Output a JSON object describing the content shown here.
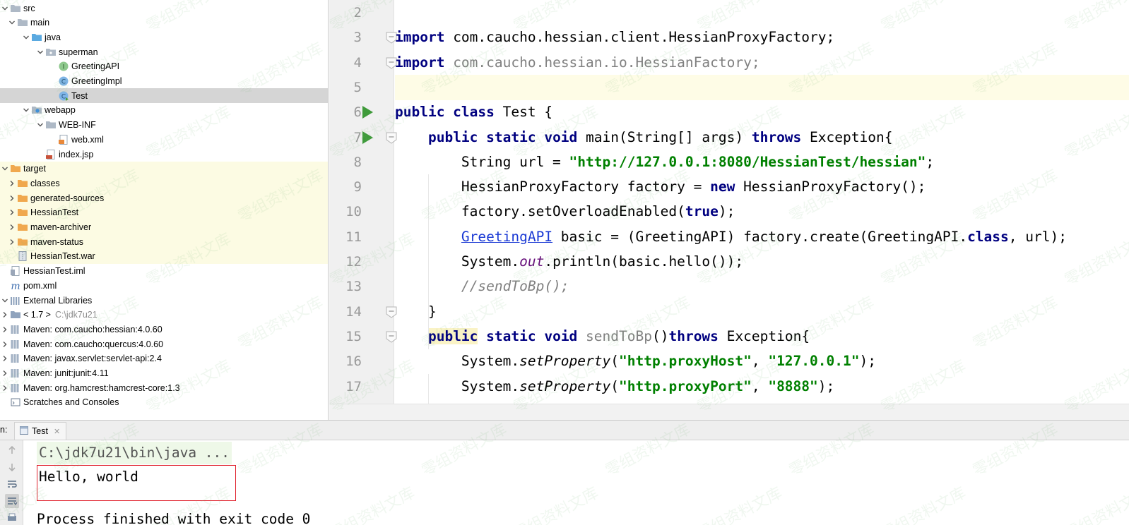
{
  "tree": [
    {
      "label": "src",
      "hint": "",
      "icon": "folder-icon",
      "expanded": true
    },
    {
      "label": "main",
      "hint": "",
      "icon": "folder-icon",
      "expanded": true
    },
    {
      "label": "java",
      "hint": "",
      "icon": "source-folder-icon",
      "expanded": true
    },
    {
      "label": "superman",
      "hint": "",
      "icon": "package-icon",
      "expanded": true
    },
    {
      "label": "GreetingAPI",
      "hint": "",
      "icon": "interface-icon",
      "expanded": null
    },
    {
      "label": "GreetingImpl",
      "hint": "",
      "icon": "class-icon",
      "expanded": null
    },
    {
      "label": "Test",
      "hint": "",
      "icon": "class-runnable-icon",
      "expanded": null,
      "selected": true
    },
    {
      "label": "webapp",
      "hint": "",
      "icon": "web-folder-icon",
      "expanded": true
    },
    {
      "label": "WEB-INF",
      "hint": "",
      "icon": "folder-icon",
      "expanded": true
    },
    {
      "label": "web.xml",
      "hint": "",
      "icon": "xml-file-icon",
      "expanded": null
    },
    {
      "label": "index.jsp",
      "hint": "",
      "icon": "jsp-file-icon",
      "expanded": null
    },
    {
      "label": "target",
      "hint": "",
      "icon": "excluded-folder-icon",
      "expanded": true,
      "excluded": true
    },
    {
      "label": "classes",
      "hint": "",
      "icon": "excluded-folder-icon",
      "expanded": false,
      "excluded": true
    },
    {
      "label": "generated-sources",
      "hint": "",
      "icon": "excluded-folder-icon",
      "expanded": false,
      "excluded": true
    },
    {
      "label": "HessianTest",
      "hint": "",
      "icon": "excluded-folder-icon",
      "expanded": false,
      "excluded": true
    },
    {
      "label": "maven-archiver",
      "hint": "",
      "icon": "excluded-folder-icon",
      "expanded": false,
      "excluded": true
    },
    {
      "label": "maven-status",
      "hint": "",
      "icon": "excluded-folder-icon",
      "expanded": false,
      "excluded": true
    },
    {
      "label": "HessianTest.war",
      "hint": "",
      "icon": "archive-file-icon",
      "expanded": null,
      "excluded": true
    },
    {
      "label": "HessianTest.iml",
      "hint": "",
      "icon": "module-file-icon",
      "expanded": null
    },
    {
      "label": "pom.xml",
      "hint": "",
      "icon": "maven-pom-icon",
      "expanded": null
    },
    {
      "label": "External Libraries",
      "hint": "",
      "icon": "libraries-icon",
      "expanded": true
    },
    {
      "label": "< 1.7 >",
      "hint": "C:\\jdk7u21",
      "icon": "jdk-icon",
      "expanded": false
    },
    {
      "label": "Maven: com.caucho:hessian:4.0.60",
      "hint": "",
      "icon": "library-icon",
      "expanded": false
    },
    {
      "label": "Maven: com.caucho:quercus:4.0.60",
      "hint": "",
      "icon": "library-icon",
      "expanded": false
    },
    {
      "label": "Maven: javax.servlet:servlet-api:2.4",
      "hint": "",
      "icon": "library-icon",
      "expanded": false
    },
    {
      "label": "Maven: junit:junit:4.11",
      "hint": "",
      "icon": "library-icon",
      "expanded": false
    },
    {
      "label": "Maven: org.hamcrest:hamcrest-core:1.3",
      "hint": "",
      "icon": "library-icon",
      "expanded": false
    },
    {
      "label": "Scratches and Consoles",
      "hint": "",
      "icon": "scratches-icon",
      "expanded": null
    }
  ],
  "editor": {
    "lines": [
      {
        "no": "2",
        "tokens": []
      },
      {
        "no": "3",
        "tokens": [
          [
            "kw",
            "import"
          ],
          [
            "",
            " com.caucho.hessian.client.HessianProxyFactory;"
          ]
        ]
      },
      {
        "no": "4",
        "tokens": [
          [
            "kw",
            "import"
          ],
          [
            "unused",
            " com.caucho.hessian.io.HessianFactory;"
          ]
        ]
      },
      {
        "no": "5",
        "tokens": [],
        "current": true
      },
      {
        "no": "6",
        "tokens": [
          [
            "kw",
            "public class"
          ],
          [
            "",
            " Test {"
          ]
        ]
      },
      {
        "no": "7",
        "tokens": [
          [
            "",
            "    "
          ],
          [
            "kw",
            "public static void"
          ],
          [
            "",
            " main(String[] args) "
          ],
          [
            "kw",
            "throws"
          ],
          [
            "",
            " Exception{"
          ]
        ]
      },
      {
        "no": "8",
        "tokens": [
          [
            "",
            "        String url = "
          ],
          [
            "str",
            "\"http://127.0.0.1:8080/HessianTest/hessian\""
          ],
          [
            "",
            ";"
          ]
        ]
      },
      {
        "no": "9",
        "tokens": [
          [
            "",
            "        HessianProxyFactory factory = "
          ],
          [
            "kw",
            "new"
          ],
          [
            "",
            " HessianProxyFactory();"
          ]
        ]
      },
      {
        "no": "10",
        "tokens": [
          [
            "",
            "        factory.setOverloadEnabled("
          ],
          [
            "kw",
            "true"
          ],
          [
            "",
            ");"
          ]
        ]
      },
      {
        "no": "11",
        "tokens": [
          [
            "",
            "        "
          ],
          [
            "lnk",
            "GreetingAPI"
          ],
          [
            "",
            " basic = (GreetingAPI) factory.create(GreetingAPI."
          ],
          [
            "kw",
            "class"
          ],
          [
            "",
            ", url);"
          ]
        ]
      },
      {
        "no": "12",
        "tokens": [
          [
            "",
            "        System."
          ],
          [
            "fld",
            "out"
          ],
          [
            "",
            ".println(basic.hello());"
          ]
        ]
      },
      {
        "no": "13",
        "tokens": [
          [
            "",
            "        "
          ],
          [
            "cmt",
            "//sendToBp();"
          ]
        ]
      },
      {
        "no": "14",
        "tokens": [
          [
            "",
            "    }"
          ]
        ]
      },
      {
        "no": "15",
        "tokens": [
          [
            "",
            "    "
          ],
          [
            "kw hl-word",
            "public"
          ],
          [
            "kw",
            " static void"
          ],
          [
            "unused",
            " sendToBp"
          ],
          [
            "",
            "()"
          ],
          [
            "kw",
            "throws"
          ],
          [
            "",
            " Exception{"
          ]
        ]
      },
      {
        "no": "16",
        "tokens": [
          [
            "",
            "        System."
          ],
          [
            "stat",
            "setProperty"
          ],
          [
            "",
            "("
          ],
          [
            "str",
            "\"http.proxyHost\""
          ],
          [
            "",
            ", "
          ],
          [
            "str",
            "\"127.0.0.1\""
          ],
          [
            "",
            ");"
          ]
        ]
      },
      {
        "no": "17",
        "tokens": [
          [
            "",
            "        System."
          ],
          [
            "stat",
            "setProperty"
          ],
          [
            "",
            "("
          ],
          [
            "str",
            "\"http.proxyPort\""
          ],
          [
            "",
            ", "
          ],
          [
            "str",
            "\"8888\""
          ],
          [
            "",
            ");"
          ]
        ]
      }
    ],
    "run_icon_lines": [
      "6",
      "7"
    ],
    "fold_icon_lines": [
      "3",
      "4",
      "7",
      "14",
      "15"
    ]
  },
  "run_panel": {
    "label": "n:",
    "tab_label": "Test",
    "tab_icon": "run-config-icon",
    "console_command": "C:\\jdk7u21\\bin\\java ...",
    "console_output": "Hello, world",
    "console_more": "Process finished with exit code 0"
  },
  "watermark": "零组资料文库",
  "colors": {
    "keyword": "#000080",
    "string": "#008000",
    "comment": "#808080",
    "selection": "#d5d5d5",
    "excluded_bg": "#fcfbe3",
    "highlight_box": "#e0202c"
  }
}
